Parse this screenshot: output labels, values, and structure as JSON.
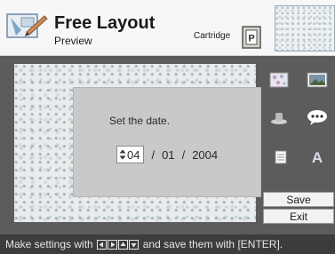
{
  "header": {
    "title": "Free Layout",
    "subtitle": "Preview",
    "cartridge_label": "Cartridge",
    "cartridge_icon_letter": "P",
    "app_icon": "layout-icon"
  },
  "tools": {
    "icons": [
      "pattern-icon",
      "image-icon",
      "stamp-icon",
      "speech-bubble-icon",
      "calendar-icon",
      "text-icon"
    ],
    "save_label": "Save",
    "exit_label": "Exit"
  },
  "dialog": {
    "title": "Set the date.",
    "month": "04",
    "day": "01",
    "year": "2004",
    "separator": "/"
  },
  "status": {
    "prefix": "Make settings with",
    "arrow_icons": [
      "left-arrow-icon",
      "right-arrow-icon",
      "up-arrow-icon",
      "down-arrow-icon"
    ],
    "suffix": "and save them with [ENTER]."
  },
  "colors": {
    "background": "#5c5c5c",
    "header_bg": "#f7f7f7",
    "dialog_bg": "#c9c9c9",
    "status_bg": "#3c3c3c",
    "status_text": "#e6e6e6"
  }
}
